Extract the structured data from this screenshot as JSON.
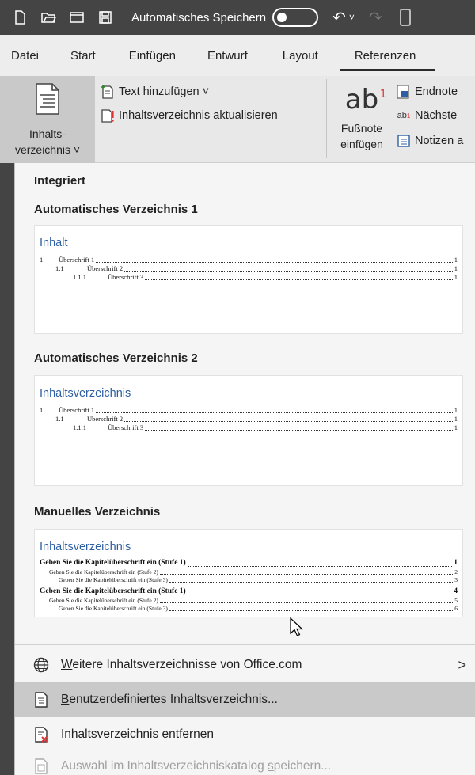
{
  "titlebar": {
    "title": "Automatisches Speichern",
    "icons": [
      "new-document-icon",
      "open-folder-icon",
      "window-icon",
      "save-icon",
      "undo-icon",
      "redo-icon"
    ]
  },
  "tabs": [
    "Datei",
    "Start",
    "Einfügen",
    "Entwurf",
    "Layout",
    "Referenzen"
  ],
  "active_tab": "Referenzen",
  "ribbon": {
    "toc_button": {
      "line1": "Inhalts-",
      "line2": "verzeichnis ˅"
    },
    "add_text": "Text hinzufügen ˅",
    "update_toc": "Inhaltsverzeichnis aktualisieren",
    "footnote": {
      "glyph": "ab",
      "sup": "1",
      "line1": "Fußnote",
      "line2": "einfügen"
    },
    "endnote": "Endnote",
    "next": "Nächste",
    "notes": "Notizen a"
  },
  "panel": {
    "section_integrated": "Integriert",
    "auto1": {
      "heading": "Automatisches Verzeichnis 1",
      "title": "Inhalt",
      "lines": [
        {
          "num": "1",
          "text": "Überschrift 1",
          "page": "1"
        },
        {
          "num": "1.1",
          "text": "Überschrift 2",
          "page": "1"
        },
        {
          "num": "1.1.1",
          "text": "Überschrift 3",
          "page": "1"
        }
      ]
    },
    "auto2": {
      "heading": "Automatisches Verzeichnis 2",
      "title": "Inhaltsverzeichnis",
      "lines": [
        {
          "num": "1",
          "text": "Überschrift 1",
          "page": "1"
        },
        {
          "num": "1.1",
          "text": "Überschrift 2",
          "page": "1"
        },
        {
          "num": "1.1.1",
          "text": "Überschrift 3",
          "page": "1"
        }
      ]
    },
    "manual": {
      "heading": "Manuelles Verzeichnis",
      "title": "Inhaltsverzeichnis",
      "lines": [
        {
          "text": "Geben Sie die Kapitelüberschrift ein (Stufe 1)",
          "page": "1"
        },
        {
          "text": "Geben Sie die Kapitelüberschrift ein (Stufe 2)",
          "page": "2"
        },
        {
          "text": "Geben Sie die Kapitelüberschrift ein (Stufe 3)",
          "page": "3"
        },
        {
          "text": "Geben Sie die Kapitelüberschrift ein (Stufe 1)",
          "page": "4"
        },
        {
          "text": "Geben Sie die Kapitelüberschrift ein (Stufe 2)",
          "page": "5"
        },
        {
          "text": "Geben Sie die Kapitelüberschrift ein (Stufe 3)",
          "page": "6"
        }
      ]
    }
  },
  "menu": {
    "more": {
      "u": "W",
      "rest": "eitere Inhaltsverzeichnisse von Office.com",
      "chevron": ">"
    },
    "custom": {
      "u": "B",
      "rest": "enutzerdefiniertes Inhaltsverzeichnis..."
    },
    "remove": {
      "pre": "Inhaltsverzeichnis ent",
      "u": "f",
      "post": "ernen"
    },
    "save": {
      "pre": "Auswahl im Inhaltsverzeichniskatalog ",
      "u": "s",
      "post": "peichern..."
    }
  },
  "colors": {
    "accent_blue": "#2e5fa3",
    "titlebar": "#444444",
    "hover": "#c9c9c9"
  }
}
